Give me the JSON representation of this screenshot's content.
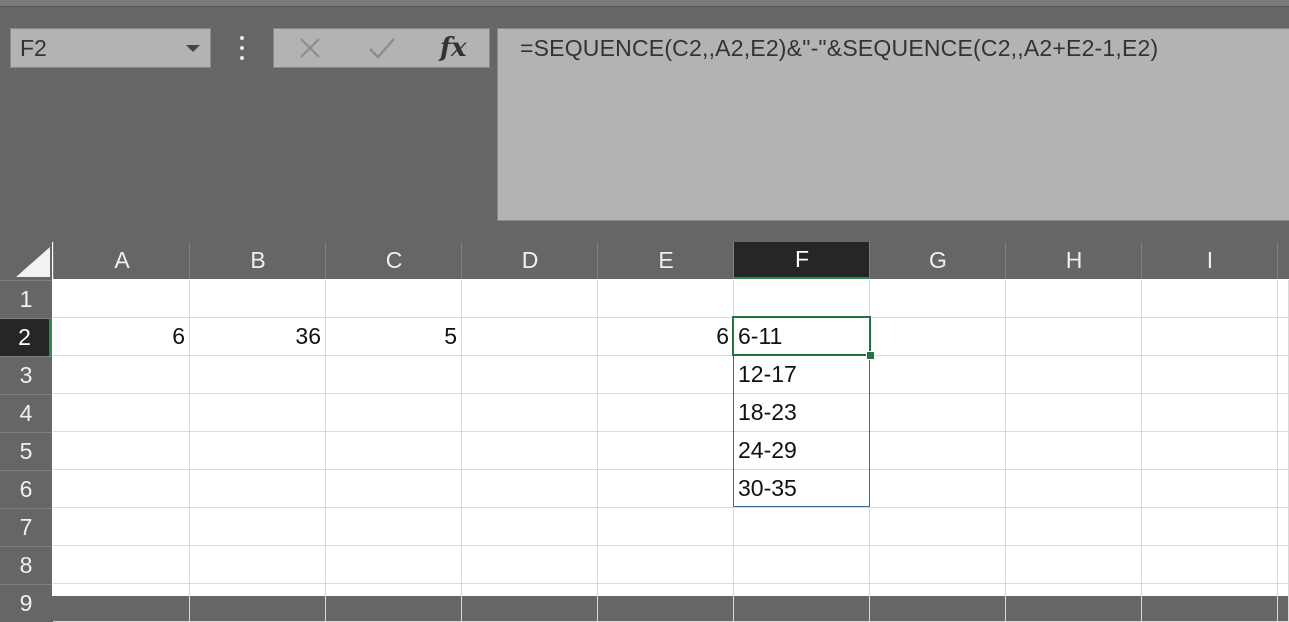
{
  "name_box": {
    "value": "F2"
  },
  "formula_bar": {
    "cancel_icon": "x-icon",
    "enter_icon": "check-icon",
    "insert_function_label": "fx",
    "formula": "=SEQUENCE(C2,,A2,E2)&\"-\"&SEQUENCE(C2,,A2+E2-1,E2)"
  },
  "columns": [
    "A",
    "B",
    "C",
    "D",
    "E",
    "F",
    "G",
    "H",
    "I"
  ],
  "rows": [
    "1",
    "2",
    "3",
    "4",
    "5",
    "6",
    "7",
    "8",
    "9"
  ],
  "selected_column": "F",
  "selected_row": "2",
  "cells": {
    "A2": "6",
    "B2": "36",
    "C2": "5",
    "E2": "6",
    "F2": "6-11",
    "F3": "12-17",
    "F4": "18-23",
    "F5": "24-29",
    "F6": "30-35"
  },
  "colors": {
    "selection_green": "#217346",
    "spill_border": "#3e6b94",
    "chrome_gray": "#666666",
    "formula_bg": "#b3b3b3"
  }
}
